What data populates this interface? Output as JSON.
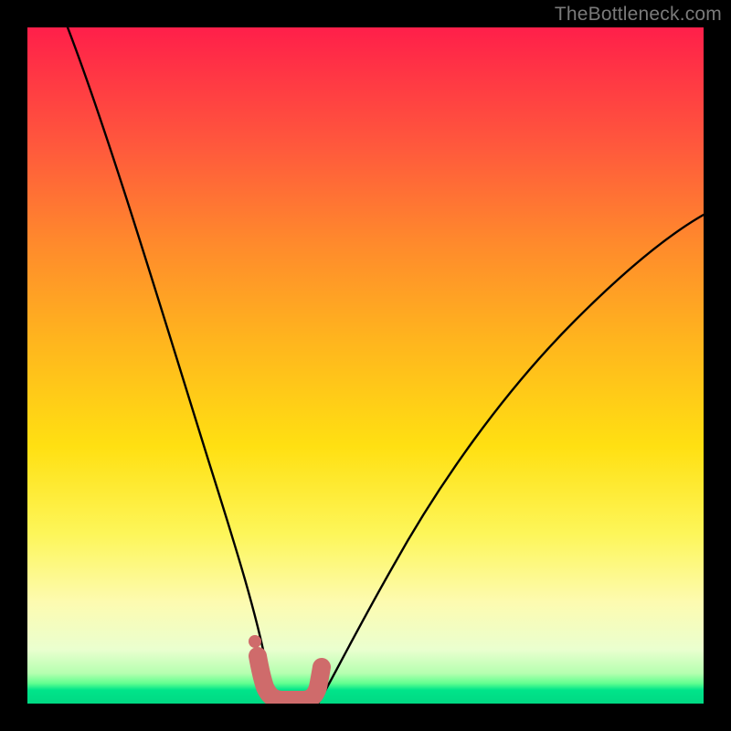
{
  "watermark": "TheBottleneck.com",
  "chart_data": {
    "type": "line",
    "title": "",
    "xlabel": "",
    "ylabel": "",
    "xlim": [
      0,
      100
    ],
    "ylim": [
      0,
      100
    ],
    "grid": false,
    "legend": false,
    "background": "red-yellow-green vertical gradient",
    "series": [
      {
        "name": "left-curve",
        "color": "#000000",
        "x": [
          6,
          10,
          14,
          18,
          22,
          25,
          28,
          30,
          32,
          33.5,
          35
        ],
        "y": [
          100,
          85,
          70,
          54,
          38,
          26,
          15,
          8,
          3,
          1,
          0
        ]
      },
      {
        "name": "right-curve",
        "color": "#000000",
        "x": [
          42,
          45,
          50,
          56,
          62,
          70,
          78,
          86,
          94,
          100
        ],
        "y": [
          0,
          3,
          10,
          20,
          30,
          42,
          52,
          60,
          67,
          72
        ]
      },
      {
        "name": "trough-highlight",
        "color": "#d86a6a",
        "style": "thick-rounded",
        "x": [
          33,
          34,
          35,
          36,
          38,
          40,
          42
        ],
        "y": [
          4,
          1,
          0,
          0,
          0,
          0,
          1
        ]
      },
      {
        "name": "marker-dot",
        "type": "scatter",
        "color": "#d86a6a",
        "x": [
          32.5
        ],
        "y": [
          6
        ]
      }
    ]
  }
}
